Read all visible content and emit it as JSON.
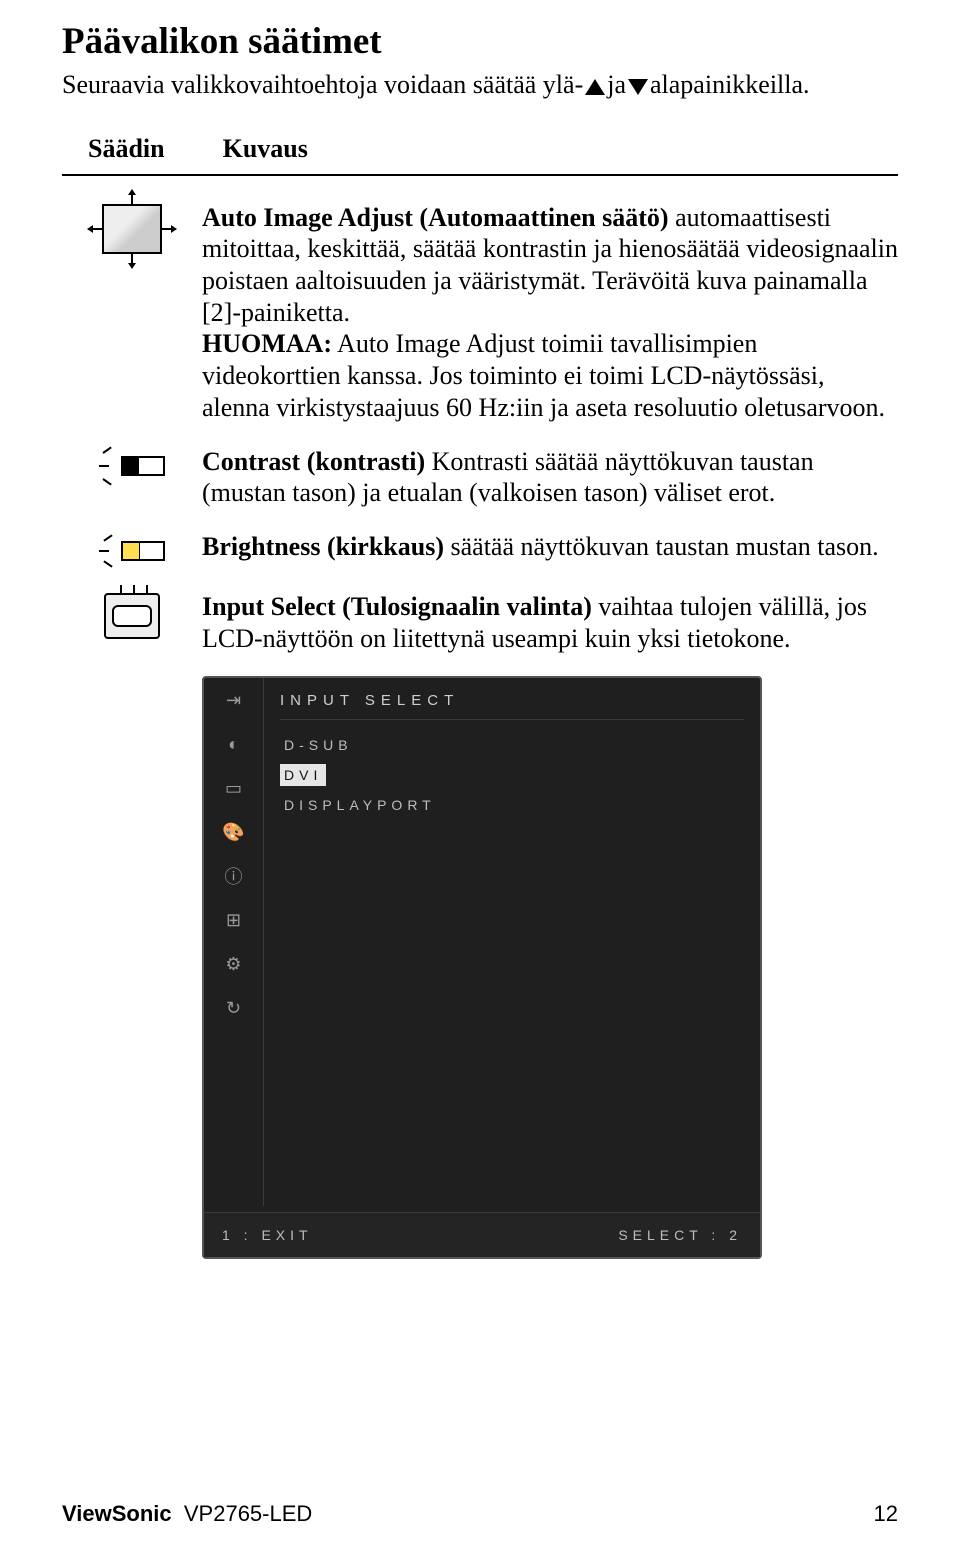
{
  "title": "Päävalikon säätimet",
  "subtitle_before": "Seuraavia valikkovaihtoehtoja voidaan säätää ylä-",
  "subtitle_mid": "ja",
  "subtitle_after": "alapainikkeilla.",
  "headers": {
    "control": "Säädin",
    "description": "Kuvaus"
  },
  "items": {
    "auto": {
      "bold": "Auto Image Adjust (Automaattinen säätö)",
      "text1": " automaattisesti mitoittaa, keskittää, säätää kontrastin ja hienosäätää videosignaalin poistaen aaltoisuuden ja vääristymät. Terävöitä kuva painamalla [2]-painiketta.",
      "bold2": "HUOMAA:",
      "text2": " Auto Image Adjust toimii tavallisimpien videokorttien kanssa. Jos toiminto ei toimi LCD-näytössäsi, alenna virkistystaajuus 60 Hz:iin ja aseta resoluutio oletusarvoon."
    },
    "contrast": {
      "bold": "Contrast (kontrasti)",
      "text": " Kontrasti säätää näyttökuvan taustan (mustan tason) ja etualan (valkoisen tason) väliset erot."
    },
    "brightness": {
      "bold": "Brightness (kirkkaus)",
      "text": " säätää näyttökuvan taustan mustan tason."
    },
    "input": {
      "bold": "Input Select (Tulosignaalin valinta)",
      "text": " vaihtaa tulojen välillä,  jos LCD-näyttöön on liitettynä useampi kuin yksi tietokone."
    }
  },
  "osd": {
    "title": "INPUT SELECT",
    "items": [
      "D-SUB",
      "DVI",
      "DISPLAYPORT"
    ],
    "selected_index": 1,
    "footer_left": "1 : EXIT",
    "footer_right": "SELECT : 2"
  },
  "footer": {
    "brand": "ViewSonic",
    "model": "VP2765-LED",
    "page": "12"
  }
}
